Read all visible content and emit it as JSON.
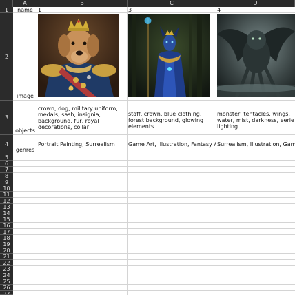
{
  "sheet": {
    "columns": [
      "A",
      "B",
      "C",
      "D"
    ],
    "rows": [
      "1",
      "2",
      "3",
      "4",
      "5",
      "6",
      "7",
      "8",
      "9",
      "10",
      "11",
      "12",
      "13",
      "14",
      "15",
      "16",
      "17",
      "18",
      "19",
      "20",
      "21",
      "22",
      "23",
      "24",
      "25",
      "26",
      "27",
      "28"
    ]
  },
  "cells": {
    "A1": "name",
    "A2": "image",
    "A3": "objects",
    "A4": "genres",
    "B1": "1",
    "C1": "3",
    "D1": "4",
    "B3": "crown, dog, military uniform, medals, sash, insignia, background, fur, royal decorations, collar",
    "C3": "staff, crown, blue clothing, forest background, glowing elements",
    "D3": "monster, tentacles, wings, water, mist, darkness, eerie lighting",
    "B4": "Portrait Painting, Surrealism",
    "C4": "Game Art, Illustration, Fantasy Art",
    "D4": "Surrealism, Illustration, Game Art"
  },
  "images": {
    "B2": "dog-royal-portrait-image",
    "C2": "blue-warrior-queen-image",
    "D2": "tentacle-monster-image"
  },
  "colors": {
    "header_bg": "#2b2b2b",
    "header_text": "#e0e0e0",
    "grid": "#d4d4d4"
  }
}
